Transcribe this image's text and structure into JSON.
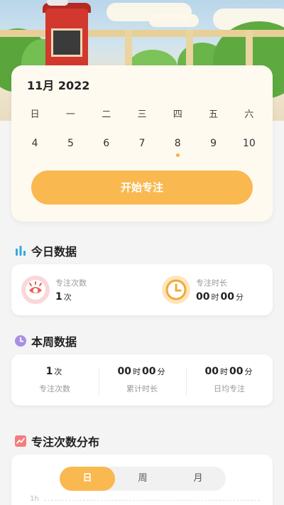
{
  "calendar": {
    "month_label": "11月",
    "year_label": "2022",
    "weekdays": [
      "日",
      "一",
      "二",
      "三",
      "四",
      "五",
      "六"
    ],
    "dates": [
      "4",
      "5",
      "6",
      "7",
      "8",
      "9",
      "10"
    ],
    "today_index": 4,
    "start_button": "开始专注"
  },
  "today": {
    "title": "今日数据",
    "focus_count_label": "专注次数",
    "focus_count_value": "1",
    "focus_count_unit": "次",
    "focus_time_label": "专注时长",
    "focus_time_hours": "00",
    "focus_time_hours_unit": "时",
    "focus_time_minutes": "00",
    "focus_time_minutes_unit": "分"
  },
  "week": {
    "title": "本周数据",
    "cols": [
      {
        "value": "1",
        "unit": "次",
        "label": "专注次数"
      },
      {
        "hours": "00",
        "hours_unit": "时",
        "minutes": "00",
        "minutes_unit": "分",
        "label": "累计时长"
      },
      {
        "hours": "00",
        "hours_unit": "时",
        "minutes": "00",
        "minutes_unit": "分",
        "label": "日均专注"
      }
    ]
  },
  "distribution": {
    "title": "专注次数分布",
    "tabs": [
      "日",
      "周",
      "月"
    ],
    "active_tab": 0,
    "axis_label": "1h"
  },
  "colors": {
    "accent": "#f9b850",
    "today_icon_bg": "#fbd7d7",
    "today_icon_fg": "#e85a55",
    "time_icon_bg": "#fde6bd",
    "time_icon_fg": "#f1a935"
  },
  "icons": [
    "bar-chart-icon",
    "eye-icon",
    "clock-icon",
    "week-clock-icon",
    "trend-chart-icon"
  ]
}
